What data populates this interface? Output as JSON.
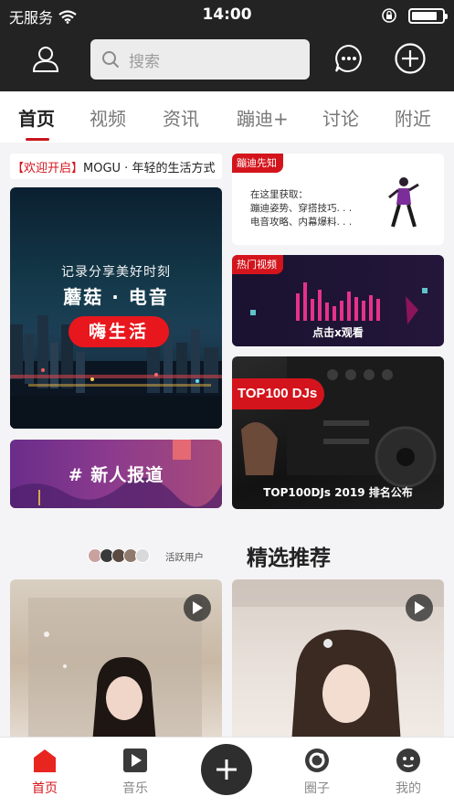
{
  "status_bar": {
    "carrier": "无服务",
    "time": "14:00",
    "battery_level": 0.85
  },
  "header": {
    "search_placeholder": "搜索"
  },
  "tabs": [
    {
      "label": "首页",
      "active": true
    },
    {
      "label": "视频",
      "active": false
    },
    {
      "label": "资讯",
      "active": false
    },
    {
      "label": "蹦迪+",
      "active": false
    },
    {
      "label": "讨论",
      "active": false
    },
    {
      "label": "附近",
      "active": false
    }
  ],
  "banner": {
    "highlight": "【欢迎开启】",
    "text": "MOGU · 年轻的生活方式"
  },
  "promo_city": {
    "subtitle": "记录分享美好时刻",
    "title": "蘑菇 · 电音",
    "pill": "嗨生活"
  },
  "promo_newcomer": {
    "title": "# 新人报道"
  },
  "knowledge_card": {
    "tag": "蹦迪先知",
    "lines": [
      "在这里获取：",
      "蹦迪姿势、穿搭技巧. . .",
      "电音攻略、内幕爆料. . ."
    ]
  },
  "hot_video_card": {
    "tag": "热门视频",
    "caption": "点击x观看"
  },
  "top100_card": {
    "badge": "TOP100 DJs",
    "caption": "TOP100DJs 2019 排名公布"
  },
  "active_users": {
    "label": "活跃用户"
  },
  "section": {
    "title": "精选推荐"
  },
  "bottom_nav": [
    {
      "label": "首页",
      "active": true,
      "icon": "home-icon"
    },
    {
      "label": "音乐",
      "active": false,
      "icon": "music-play-icon"
    },
    {
      "label": "圈子",
      "active": false,
      "icon": "circle-icon"
    },
    {
      "label": "我的",
      "active": false,
      "icon": "profile-icon"
    }
  ],
  "colors": {
    "accent": "#d4141c",
    "header_bg": "#232323",
    "fab_bg": "#2e2e2e"
  }
}
